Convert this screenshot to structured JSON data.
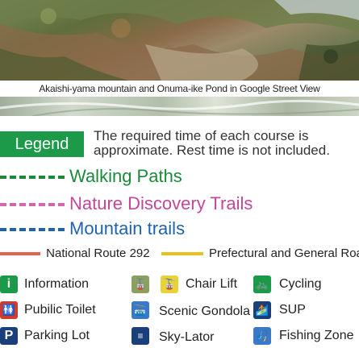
{
  "caption": "Akaishi-yama mountain and Onuma-ike Pond in Google Street View",
  "legend_label": "Legend",
  "note_line1": "The required time of each course is",
  "note_line2": "approximate. Rest time is not included.",
  "paths": [
    {
      "label": "Walking Paths",
      "color": "#1a8a3a"
    },
    {
      "label": "Nature Discovery Trails",
      "color": "#c2479a"
    },
    {
      "label": "Mountain trails",
      "color": "#1f63b0"
    }
  ],
  "routes": [
    {
      "label": "National Route 292",
      "color": "#e8614a"
    },
    {
      "label": "Prefectural and General Roads",
      "color": "#e8c21a"
    }
  ],
  "facilities": {
    "information": "Information",
    "toilet": "Pubilic Toilet",
    "parking": "Parking Lot",
    "chair_lift": "Chair Lift",
    "gondola": "Scenic Gondola",
    "skylator": "Sky-Lator",
    "cycling": "Cycling",
    "sup": "SUP",
    "fishing": "Fishing Zone"
  },
  "colors": {
    "green": "#1d9a49",
    "red": "#d23a2a",
    "blue_dark": "#1a3f7a",
    "blue_light": "#3a78c8",
    "olive": "#8aa060"
  }
}
